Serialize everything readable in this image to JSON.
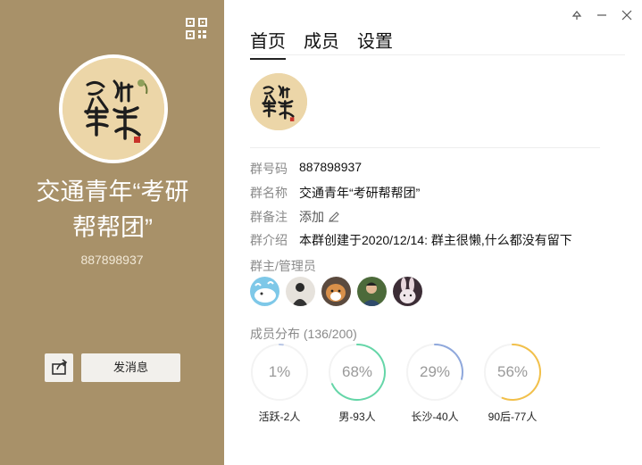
{
  "group": {
    "name": "交通青年“考研帮帮团”",
    "name_line1": "交通青年“考研",
    "name_line2": "帮帮团”",
    "number": "887898937"
  },
  "left_panel": {
    "send_message_label": "发消息",
    "background": "#a89169"
  },
  "tabs": [
    {
      "label": "首页",
      "active": true
    },
    {
      "label": "成员",
      "active": false
    },
    {
      "label": "设置",
      "active": false
    }
  ],
  "info": {
    "number_label": "群号码",
    "number_value": "887898937",
    "name_label": "群名称",
    "name_value": "交通青年“考研帮帮团”",
    "remark_label": "群备注",
    "remark_value": "添加",
    "intro_label": "群介绍",
    "intro_value": "本群创建于2020/12/14:  群主很懒,什么都没有留下"
  },
  "admins_label": "群主/管理员",
  "admins": [
    "whale-avatar",
    "person-avatar",
    "dog-avatar",
    "boy-avatar",
    "rabbit-avatar"
  ],
  "distribution": {
    "label": "成员分布 (136/200)",
    "items": [
      {
        "percent": "1%",
        "value": 0.01,
        "caption": "活跃-2人",
        "color": "#b9c7e6"
      },
      {
        "percent": "68%",
        "value": 0.68,
        "caption": "男-93人",
        "color": "#65d6a8"
      },
      {
        "percent": "29%",
        "value": 0.29,
        "caption": "长沙-40人",
        "color": "#8fa8dc"
      },
      {
        "percent": "56%",
        "value": 0.56,
        "caption": "90后-77人",
        "color": "#f2c04a"
      }
    ]
  }
}
